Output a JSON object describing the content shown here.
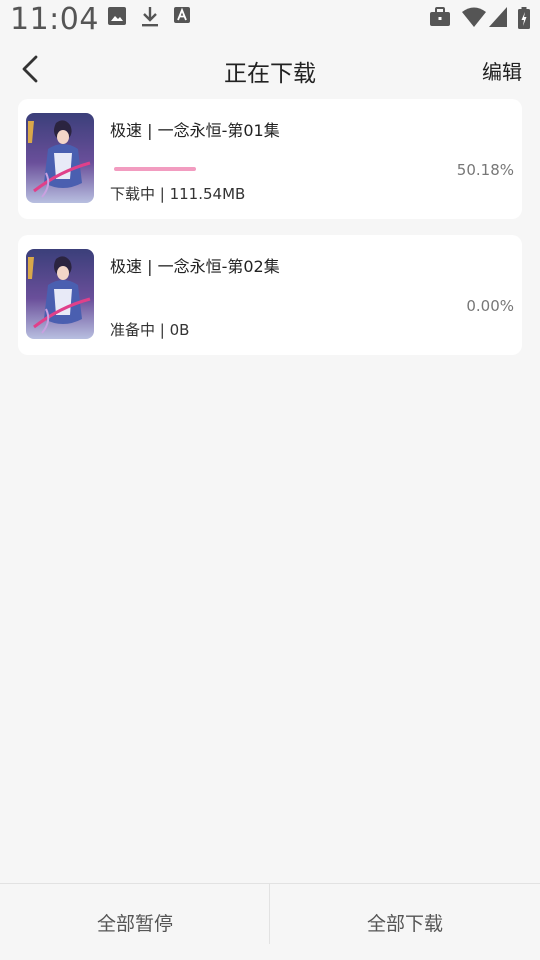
{
  "status_bar": {
    "time": "11:04",
    "icons": [
      "image-icon",
      "download-icon",
      "font-icon",
      "briefcase-icon",
      "wifi-icon",
      "signal-icon",
      "battery-icon"
    ]
  },
  "header": {
    "title": "正在下载",
    "edit_label": "编辑"
  },
  "downloads": [
    {
      "title": "极速 | 一念永恒-第01集",
      "status": "下载中 | 111.54MB",
      "percent": "50.18%",
      "progress": 0.5018
    },
    {
      "title": "极速 | 一念永恒-第02集",
      "status": "准备中 | 0B",
      "percent": "0.00%",
      "progress": 0
    }
  ],
  "bottom_bar": {
    "pause_all_label": "全部暂停",
    "download_all_label": "全部下载"
  },
  "colors": {
    "accent": "#f29cc0",
    "background": "#f6f6f6",
    "card": "#ffffff"
  }
}
